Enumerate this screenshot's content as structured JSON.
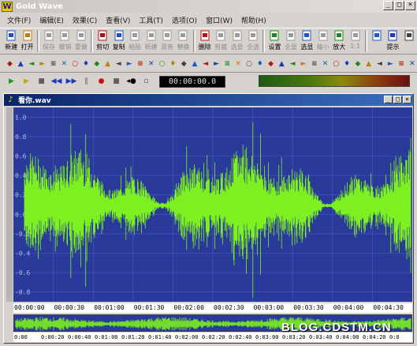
{
  "app": {
    "title": "Gold Wave",
    "logo_letter": "W"
  },
  "menu": [
    {
      "label": "文件(F)"
    },
    {
      "label": "编辑(E)"
    },
    {
      "label": "效果(C)"
    },
    {
      "label": "查看(V)"
    },
    {
      "label": "工具(T)"
    },
    {
      "label": "选项(O)"
    },
    {
      "label": "窗口(W)"
    },
    {
      "label": "帮助(H)"
    }
  ],
  "toolbar": [
    {
      "label": "新建",
      "icon": "new-file-icon",
      "enabled": true
    },
    {
      "label": "打开",
      "icon": "open-folder-icon",
      "enabled": true
    },
    {
      "label": "保存",
      "icon": "save-disk-icon",
      "enabled": false
    },
    {
      "label": "撤销",
      "icon": "undo-icon",
      "enabled": false
    },
    {
      "label": "重做",
      "icon": "redo-icon",
      "enabled": false
    },
    {
      "label": "剪切",
      "icon": "cut-icon",
      "enabled": true
    },
    {
      "label": "复制",
      "icon": "copy-icon",
      "enabled": true
    },
    {
      "label": "粘贴",
      "icon": "paste-icon",
      "enabled": false
    },
    {
      "label": "新建",
      "icon": "paste-new-icon",
      "enabled": false
    },
    {
      "label": "混音",
      "icon": "mix-icon",
      "enabled": false
    },
    {
      "label": "替换",
      "icon": "replace-icon",
      "enabled": false
    },
    {
      "label": "删除",
      "icon": "delete-icon",
      "enabled": true
    },
    {
      "label": "剪裁",
      "icon": "trim-icon",
      "enabled": false
    },
    {
      "label": "选显",
      "icon": "select-view-icon",
      "enabled": false
    },
    {
      "label": "全选",
      "icon": "select-all-icon",
      "enabled": false
    },
    {
      "label": "设置",
      "icon": "set-marker-icon",
      "enabled": true
    },
    {
      "label": "全显",
      "icon": "show-all-icon",
      "enabled": false
    },
    {
      "label": "选显",
      "icon": "zoom-selection-icon",
      "enabled": true
    },
    {
      "label": "缩小",
      "icon": "zoom-out-icon",
      "enabled": false
    },
    {
      "label": "放大",
      "icon": "zoom-in-icon",
      "enabled": true
    },
    {
      "label": "1:1",
      "icon": "zoom-1to1-icon",
      "enabled": false
    },
    {
      "label": "",
      "icon": "zoom-alt-icon",
      "enabled": true
    },
    {
      "label": "提示",
      "icon": "cue-icon",
      "enabled": true
    },
    {
      "label": "",
      "icon": "properties-icon",
      "enabled": true
    }
  ],
  "effects_toolbar_count": 38,
  "transport": {
    "time": "00:00:00.0"
  },
  "document": {
    "title": "看你.wav"
  },
  "amplitude_labels": [
    "1.0",
    "0.8",
    "0.6",
    "0.4",
    "0.2",
    "0.0",
    "-0.2",
    "-0.4",
    "-0.6",
    "-0.8"
  ],
  "timeline": [
    "00:00:00",
    "00:00:30",
    "00:01:00",
    "00:01:30",
    "00:02:00",
    "00:02:30",
    "00:03:00",
    "00:03:30",
    "00:04:00",
    "00:04:30"
  ],
  "overview_timeline": [
    "0:00",
    "0:00:20",
    "0:00:40",
    "0:01:00",
    "0:01:20",
    "0:01:40",
    "0:02:00",
    "0:02:20",
    "0:02:40",
    "0:03:00",
    "0:03:20",
    "0:03:40",
    "0:04:00",
    "0:04:20",
    "0:0"
  ],
  "colors": {
    "waveform": "#7cf020",
    "background": "#2a3a9a",
    "gridline": "#4a5ac0"
  },
  "watermark": "BLOG.CDSTM.CN"
}
